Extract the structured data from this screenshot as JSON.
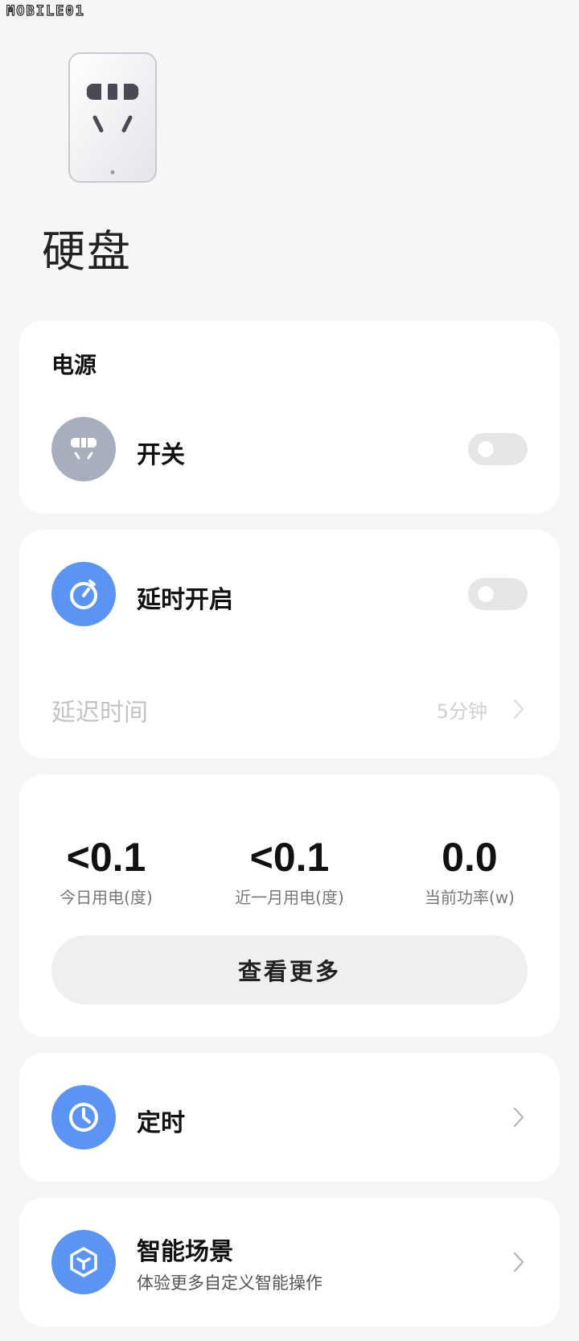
{
  "watermark": "MOBILE01",
  "device": {
    "name": "硬盘",
    "image_icon": "smart-plug-image"
  },
  "power_card": {
    "section_title": "电源",
    "switch_label": "开关",
    "switch_icon": "plug-icon",
    "switch_on": false
  },
  "delay_card": {
    "label": "延时开启",
    "icon": "stopwatch-icon",
    "toggle_on": false,
    "delay_time_label": "延迟时间",
    "delay_time_value": "5分钟"
  },
  "stats_card": {
    "stats": [
      {
        "value": "<0.1",
        "label": "今日用电(度)"
      },
      {
        "value": "<0.1",
        "label": "近一月用电(度)"
      },
      {
        "value": "0.0",
        "label": "当前功率(w)"
      }
    ],
    "more_button": "查看更多"
  },
  "timer_card": {
    "label": "定时",
    "icon": "clock-icon"
  },
  "scene_card": {
    "label": "智能场景",
    "sub": "体验更多自定义智能操作",
    "icon": "cube-icon"
  },
  "colors": {
    "background": "#f6f6f6",
    "accent_blue": "#5a95f5",
    "icon_grey": "#a8afbc",
    "toggle_off": "#e6e6e6"
  }
}
